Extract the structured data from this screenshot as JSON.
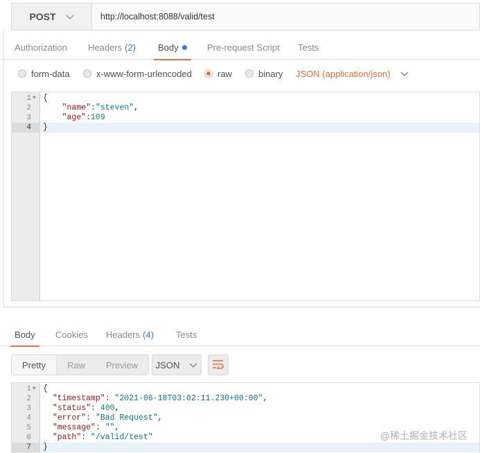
{
  "request": {
    "method": "POST",
    "url": "http://localhost:8088/valid/test",
    "tabs": [
      {
        "label": "Authorization"
      },
      {
        "label": "Headers",
        "count": "(2)"
      },
      {
        "label": "Body"
      },
      {
        "label": "Pre-request Script"
      },
      {
        "label": "Tests"
      }
    ],
    "body_types": [
      "form-data",
      "x-www-form-urlencoded",
      "raw",
      "binary"
    ],
    "selected_body_type": "raw",
    "content_type": "JSON (application/json)",
    "body_lines": [
      {
        "n": "1",
        "text": "{"
      },
      {
        "n": "2",
        "key": "\"name\"",
        "sep": ":",
        "value": "\"steven\"",
        "tail": ","
      },
      {
        "n": "3",
        "key": "\"age\"",
        "sep": ":",
        "value": "109",
        "tail": ""
      },
      {
        "n": "4",
        "text": "}"
      }
    ]
  },
  "response": {
    "tabs": [
      {
        "label": "Body"
      },
      {
        "label": "Cookies"
      },
      {
        "label": "Headers",
        "count": "(4)"
      },
      {
        "label": "Tests"
      }
    ],
    "view_modes": [
      "Pretty",
      "Raw",
      "Preview"
    ],
    "format": "JSON",
    "body_lines": [
      {
        "n": "1",
        "text": "{"
      },
      {
        "n": "2",
        "key": "\"timestamp\"",
        "sep": ": ",
        "value": "\"2021-06-18T03:02:11.230+00:00\"",
        "tail": ","
      },
      {
        "n": "3",
        "key": "\"status\"",
        "sep": ": ",
        "value": "400",
        "tail": ","
      },
      {
        "n": "4",
        "key": "\"error\"",
        "sep": ": ",
        "value": "\"Bad Request\"",
        "tail": ","
      },
      {
        "n": "5",
        "key": "\"message\"",
        "sep": ": ",
        "value": "\"\"",
        "tail": ","
      },
      {
        "n": "6",
        "key": "\"path\"",
        "sep": ": ",
        "value": "\"/valid/test\"",
        "tail": ""
      },
      {
        "n": "7",
        "text": "}"
      }
    ]
  },
  "watermark": "@稀土掘金技术社区",
  "colors": {
    "accent": "#f26b3a",
    "link": "#2b7de9"
  }
}
